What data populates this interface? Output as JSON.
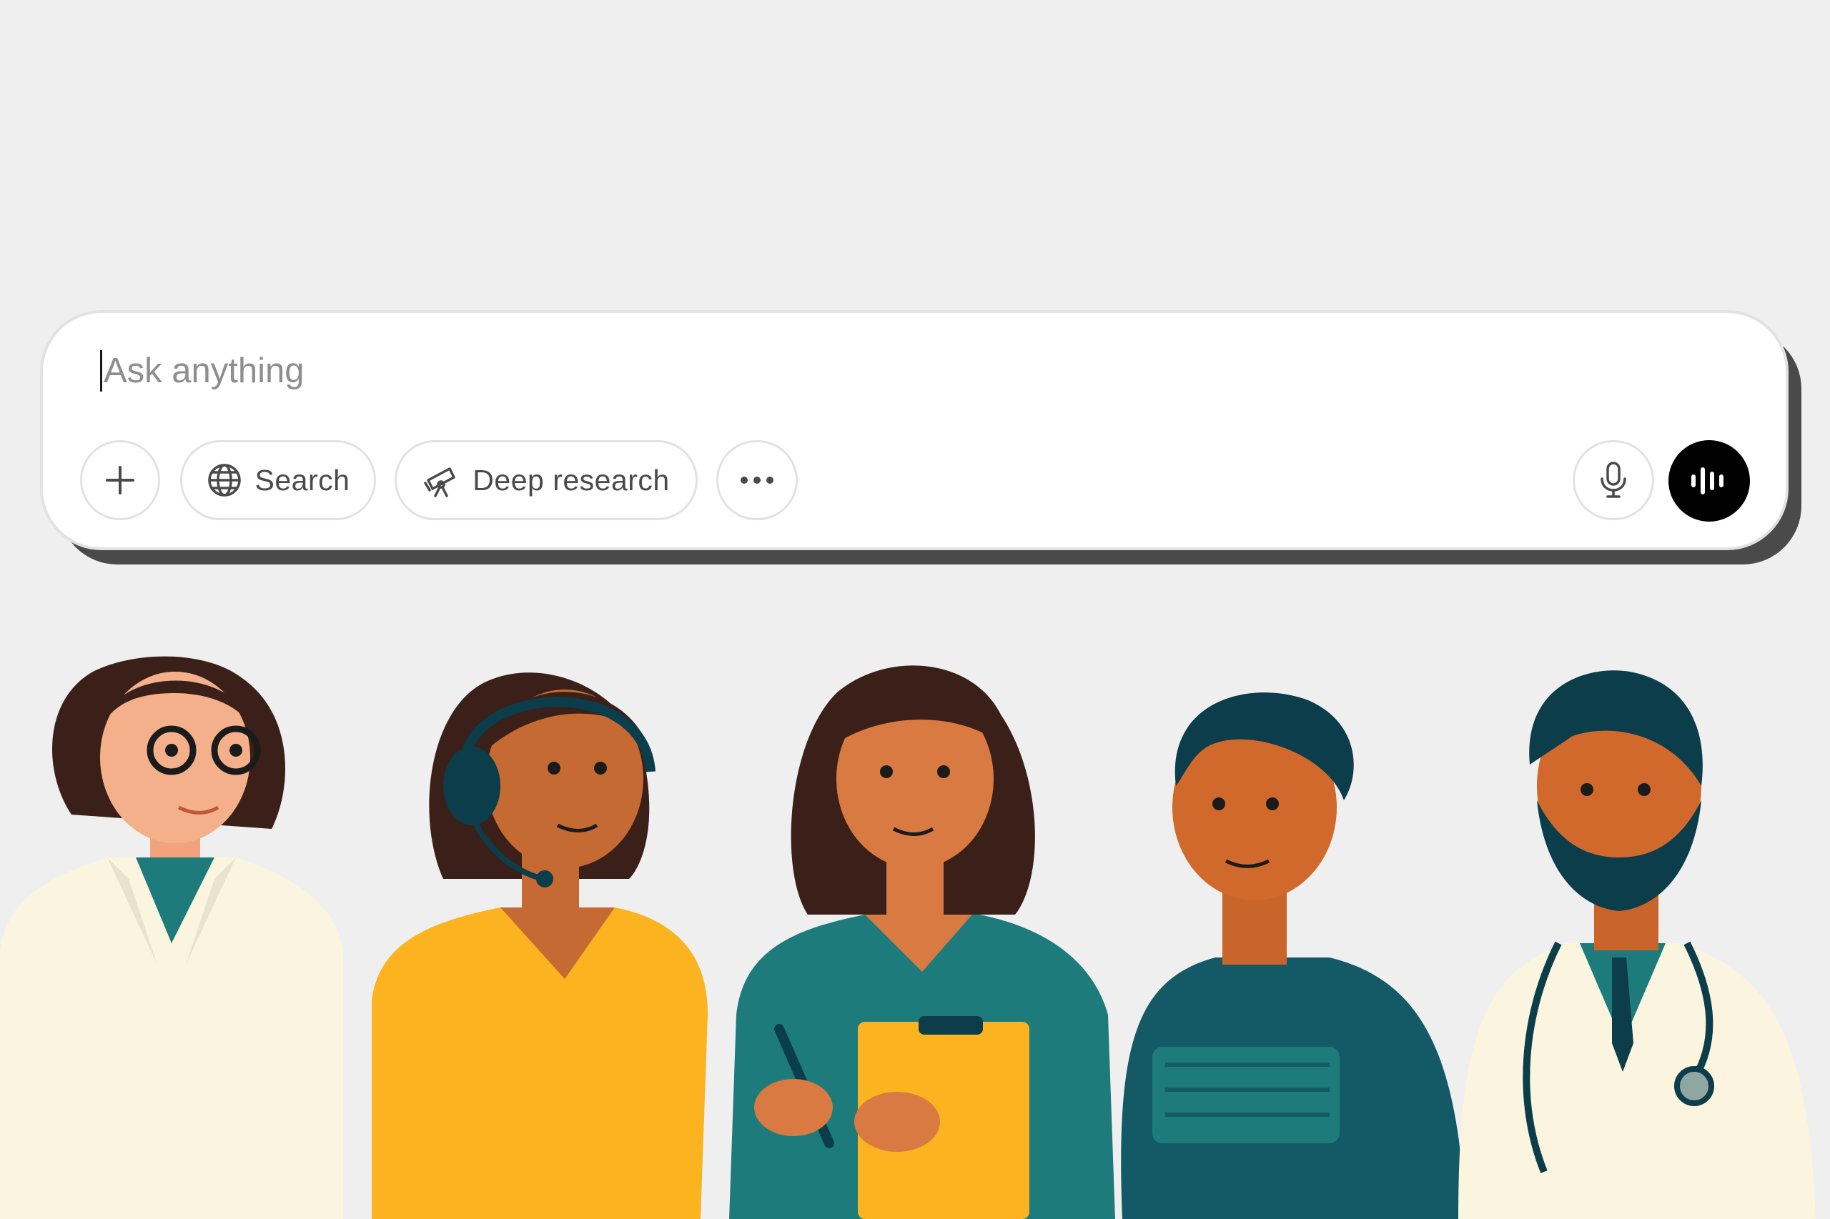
{
  "composer": {
    "placeholder": "Ask anything",
    "buttons": {
      "add_icon": "plus-icon",
      "search_label": "Search",
      "search_icon": "globe-icon",
      "deep_research_label": "Deep research",
      "deep_research_icon": "telescope-icon",
      "more_icon": "ellipsis-icon",
      "mic_icon": "microphone-icon",
      "voice_icon": "voice-waveform-icon"
    }
  },
  "colors": {
    "background": "#efefef",
    "composer": "#ffffff",
    "voice_button": "#000000",
    "text_muted": "#8e8e8e"
  },
  "illustration": {
    "people": [
      "doctor with glasses",
      "support agent with headset",
      "woman with clipboard",
      "man in sweater",
      "doctor with stethoscope"
    ]
  }
}
